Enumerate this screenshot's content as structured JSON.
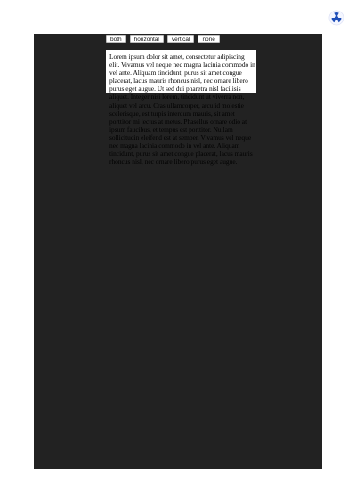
{
  "controls": {
    "buttons": [
      {
        "label": "both"
      },
      {
        "label": "horizontal"
      },
      {
        "label": "vertical"
      },
      {
        "label": "none"
      }
    ]
  },
  "content": {
    "paragraph": "Lorem ipsum dolor sit amet, consectetur adipiscing elit. Vivamus vel neque nec magna lacinia commodo in vel ante. Aliquam tincidunt, purus sit amet congue placerat, lacus mauris rhoncus nisl, nec ornare libero purus eget augue. Ut sed dui pharetra nisl facilisis aliquet. Integer nisi lorem, tincidunt ut viverra non, aliquet vel arcu. Cras ullamcorper, arcu id molestie scelerisque, est turpis interdum mauris, sit amet porttitor mi lectus at metus. Phasellus ornare odio at ipsum faucibus, et tempus est porttitor. Nullam sollicitudin eleifend est at semper. Vivamus vel neque nec magna lacinia commodo in vel ante. Aliquam tincidunt, purus sit amet congue placerat, lacus mauris rhoncus nisl, nec ornare libero purus eget augue."
  },
  "colors": {
    "page_background": "#ffffff",
    "stage_background": "#222222",
    "box_background": "#ffffff",
    "text_color": "#000000"
  },
  "icons": {
    "corner_logo": "radiation-symbol-logo"
  }
}
